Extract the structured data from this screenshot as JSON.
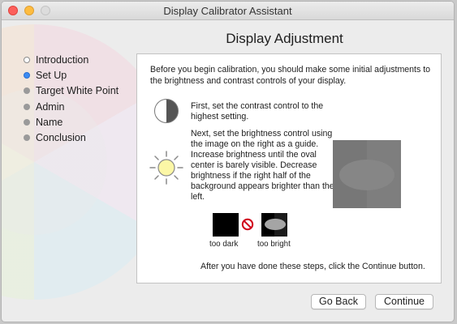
{
  "window": {
    "title": "Display Calibrator Assistant"
  },
  "step_title": "Display Adjustment",
  "steps": [
    {
      "label": "Introduction",
      "state": "done"
    },
    {
      "label": "Set Up",
      "state": "current"
    },
    {
      "label": "Target White Point",
      "state": "pending"
    },
    {
      "label": "Admin",
      "state": "pending"
    },
    {
      "label": "Name",
      "state": "pending"
    },
    {
      "label": "Conclusion",
      "state": "pending"
    }
  ],
  "content": {
    "intro": "Before you begin calibration, you should make some initial adjustments to the brightness and contrast controls of your display.",
    "contrast_text": "First, set the contrast control to the highest setting.",
    "brightness_text": "Next, set the brightness control using the image on the right as a guide.  Increase brightness until the oval center is barely visible. Decrease brightness if the right half of the background appears brighter than the left.",
    "too_dark_label": "too dark",
    "too_bright_label": "too bright",
    "after_text": "After you have done these steps, click the Continue button."
  },
  "buttons": {
    "back": "Go Back",
    "continue": "Continue"
  },
  "colors": {
    "current_step": "#3c8cf3",
    "close": "#fc605c",
    "minimize": "#fdbc40"
  },
  "icons": {
    "contrast": "contrast-icon",
    "brightness": "sun-icon",
    "no": "prohibited-icon"
  }
}
